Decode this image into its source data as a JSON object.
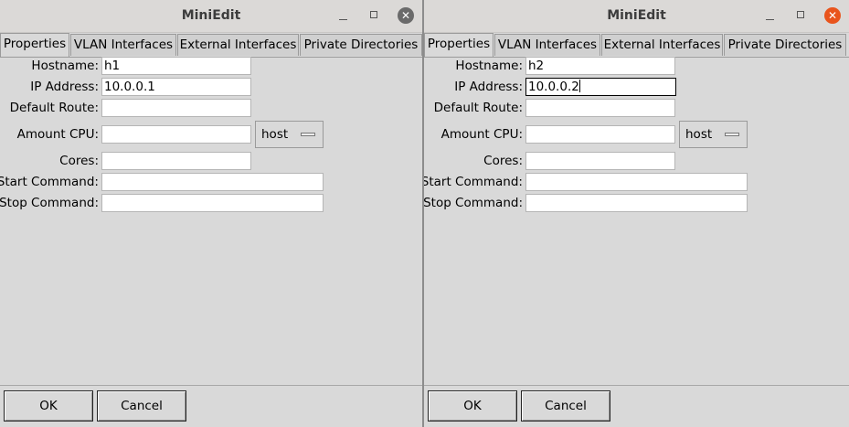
{
  "windows": [
    {
      "title": "MiniEdit",
      "tabs": [
        "Properties",
        "VLAN Interfaces",
        "External Interfaces",
        "Private Directories"
      ],
      "labels": {
        "hostname": "Hostname:",
        "ip": "IP Address:",
        "route": "Default Route:",
        "cpu": "Amount CPU:",
        "cores": "Cores:",
        "start": "Start Command:",
        "stop": "Stop Command:"
      },
      "values": {
        "hostname": "h1",
        "ip": "10.0.0.1",
        "route": "",
        "cpu": "",
        "cores": "",
        "start": "",
        "stop": ""
      },
      "cpu_menu": "host",
      "buttons": {
        "ok": "OK",
        "cancel": "Cancel"
      }
    },
    {
      "title": "MiniEdit",
      "tabs": [
        "Properties",
        "VLAN Interfaces",
        "External Interfaces",
        "Private Directories"
      ],
      "labels": {
        "hostname": "Hostname:",
        "ip": "IP Address:",
        "route": "Default Route:",
        "cpu": "Amount CPU:",
        "cores": "Cores:",
        "start": "Start Command:",
        "stop": "Stop Command:"
      },
      "values": {
        "hostname": "h2",
        "ip": "10.0.0.2",
        "route": "",
        "cpu": "",
        "cores": "",
        "start": "",
        "stop": ""
      },
      "cpu_menu": "host",
      "buttons": {
        "ok": "OK",
        "cancel": "Cancel"
      }
    }
  ]
}
